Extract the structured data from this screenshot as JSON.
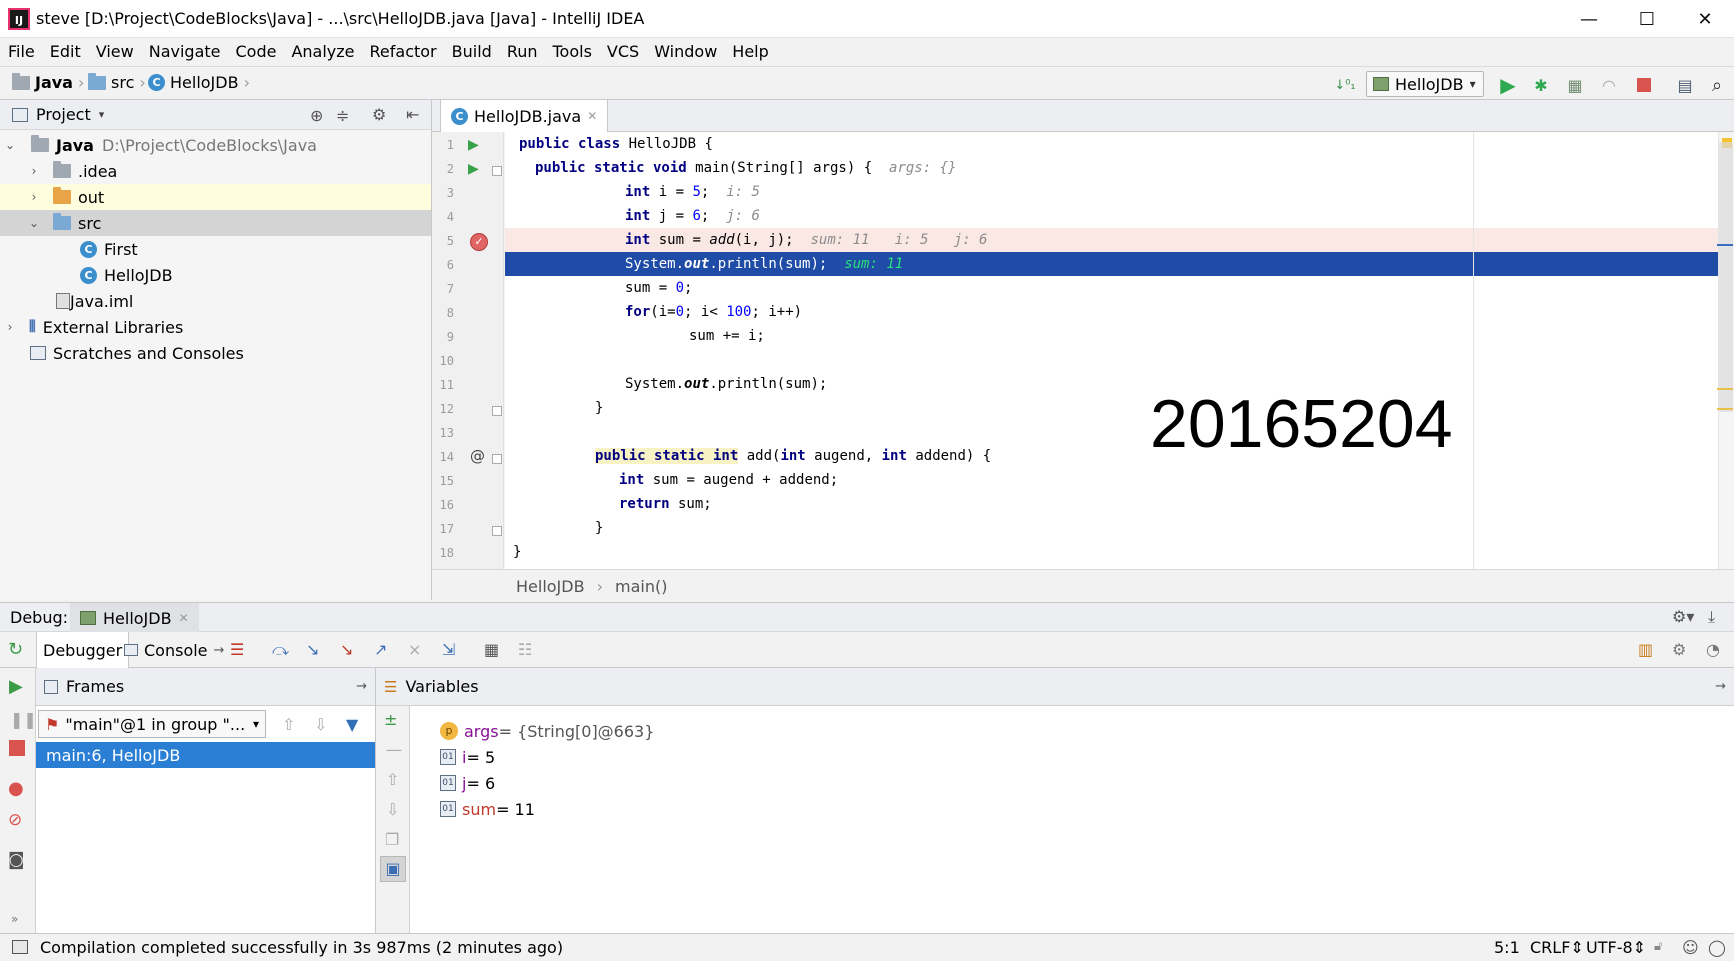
{
  "window": {
    "title": "steve [D:\\Project\\CodeBlocks\\Java] - ...\\src\\HelloJDB.java [Java] - IntelliJ IDEA",
    "app_icon": "IJ",
    "minimize": "—",
    "maximize": "☐",
    "close": "✕"
  },
  "menu": [
    "File",
    "Edit",
    "View",
    "Navigate",
    "Code",
    "Analyze",
    "Refactor",
    "Build",
    "Run",
    "Tools",
    "VCS",
    "Window",
    "Help"
  ],
  "navbar": {
    "crumbs": [
      "Java",
      "src",
      "HelloJDB"
    ],
    "run_config": "HelloJDB"
  },
  "project": {
    "title": "Project",
    "tree": [
      {
        "name": "Java",
        "path": "D:\\Project\\CodeBlocks\\Java"
      },
      {
        "name": ".idea"
      },
      {
        "name": "out"
      },
      {
        "name": "src"
      },
      {
        "name": "First"
      },
      {
        "name": "HelloJDB"
      },
      {
        "name": "Java.iml"
      },
      {
        "name": "External Libraries"
      },
      {
        "name": "Scratches and Consoles"
      }
    ]
  },
  "editor": {
    "tab": "HelloJDB.java",
    "line_numbers": [
      "1",
      "2",
      "3",
      "4",
      "5",
      "6",
      "7",
      "8",
      "9",
      "10",
      "11",
      "12",
      "13",
      "14",
      "15",
      "16",
      "17",
      "18"
    ],
    "lines": {
      "l1_kw": "public class",
      "l1_rest": " HelloJDB {",
      "l2_kw": "public static void",
      "l2_rest": " main(String[] args) {",
      "l2_hint": "args: {}",
      "l3_kw": "int",
      "l3_a": " i = ",
      "l3_num": "5",
      "l3_b": ";",
      "l3_hint": "i: 5",
      "l4_kw": "int",
      "l4_a": " j = ",
      "l4_num": "6",
      "l4_b": ";",
      "l4_hint": "j: 6",
      "l5_kw": "int",
      "l5_a": " sum = ",
      "l5_call": "add",
      "l5_b": "(i, j);",
      "l5_hint": "sum: 11   i: 5   j: 6",
      "l6_a": "System.",
      "l6_out": "out",
      "l6_b": ".println(sum);",
      "l6_hint": "sum: 11",
      "l7_a": "sum = ",
      "l7_num": "0",
      "l7_b": ";",
      "l8_kw": "for",
      "l8_a": "(i=",
      "l8_n1": "0",
      "l8_b": "; i< ",
      "l8_n2": "100",
      "l8_c": "; i++)",
      "l9": "sum += i;",
      "l11_a": "System.",
      "l11_out": "out",
      "l11_b": ".println(sum);",
      "l12": "}",
      "l14_kw1": "public static int",
      "l14_a": " add(",
      "l14_kw2": "int",
      "l14_b": " augend, ",
      "l14_kw3": "int",
      "l14_c": " addend) {",
      "l15_kw": "int",
      "l15_a": " sum = augend + addend;",
      "l16_kw": "return",
      "l16_a": " sum;",
      "l17": "}",
      "l18": "}"
    },
    "watermark": "20165204",
    "breadcrumb": [
      "HelloJDB",
      "main()"
    ]
  },
  "debug": {
    "label": "Debug:",
    "session_tab": "HelloJDB",
    "tab_debugger": "Debugger",
    "tab_console": "Console",
    "frames_title": "Frames",
    "thread_select": "\"main\"@1 in group \"...",
    "frame": "main:6, HelloJDB",
    "variables_title": "Variables",
    "variables": [
      {
        "name": "args",
        "value": " = {String[0]@663}"
      },
      {
        "name": "i",
        "value": " = 5"
      },
      {
        "name": "j",
        "value": " = 6"
      },
      {
        "name": "sum",
        "value": " = 11"
      }
    ]
  },
  "status": {
    "message": "Compilation completed successfully in 3s 987ms (2 minutes ago)",
    "position": "5:1",
    "line_sep": "CRLF",
    "encoding": "UTF-8"
  },
  "colors": {
    "current_line": "#1e4ca6",
    "breakpoint_line": "#fae8e5",
    "frame_selected": "#2a7fd4",
    "keyword": "#000080",
    "number": "#0000ff"
  }
}
